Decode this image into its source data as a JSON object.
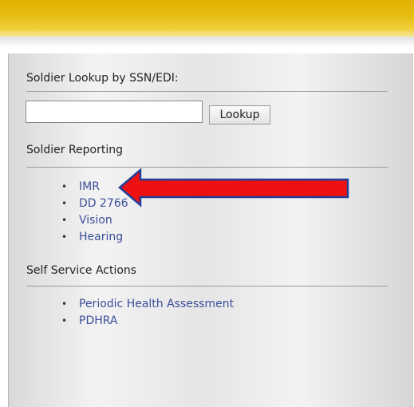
{
  "lookup": {
    "heading": "Soldier Lookup by SSN/EDI:",
    "input_value": "",
    "input_placeholder": "",
    "button_label": "Lookup"
  },
  "soldier_reporting": {
    "heading": "Soldier Reporting",
    "items": [
      {
        "bullet": "•",
        "label": "IMR"
      },
      {
        "bullet": "•",
        "label": "DD 2766"
      },
      {
        "bullet": "•",
        "label": "Vision"
      },
      {
        "bullet": "•",
        "label": "Hearing"
      }
    ]
  },
  "self_service": {
    "heading": "Self Service Actions",
    "items": [
      {
        "bullet": "•",
        "label": "Periodic Health Assessment"
      },
      {
        "bullet": "•",
        "label": "PDHRA"
      }
    ]
  },
  "colors": {
    "header_gold": "#e3b100",
    "link_blue": "#3a4f9a",
    "arrow_red": "#ee1111",
    "arrow_outline": "#1f3f9a"
  },
  "annotations": {
    "arrow_icon": "red-left-arrow-icon",
    "arrow_target": "IMR"
  }
}
